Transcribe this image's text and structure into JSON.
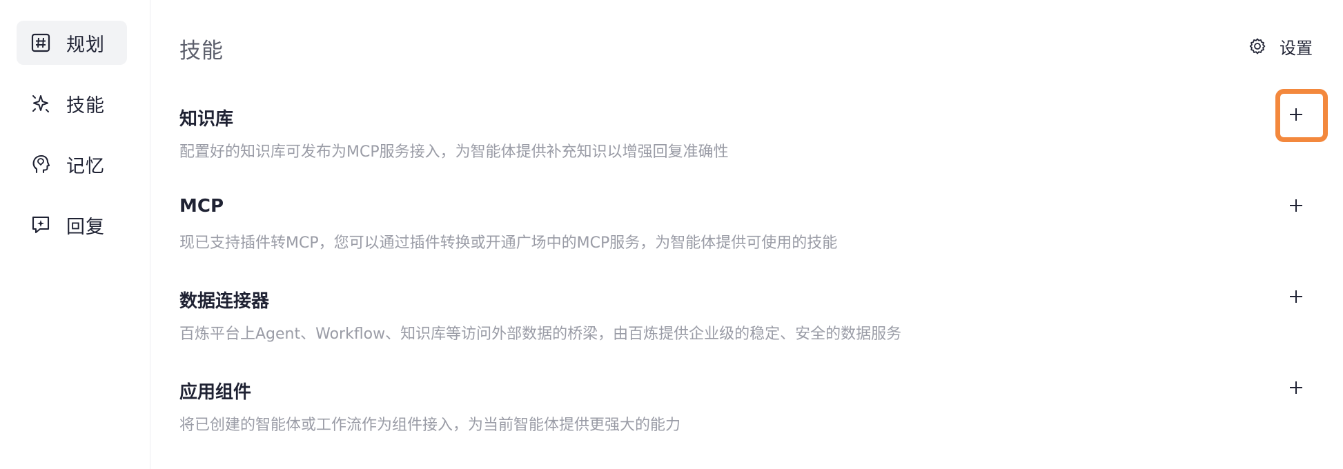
{
  "sidebar": {
    "items": [
      {
        "label": "规划",
        "icon": "hash-icon",
        "active": true
      },
      {
        "label": "技能",
        "icon": "sparkle-icon",
        "active": false
      },
      {
        "label": "记忆",
        "icon": "head-icon",
        "active": false
      },
      {
        "label": "回复",
        "icon": "chat-sparkle-icon",
        "active": false
      }
    ]
  },
  "header": {
    "title": "技能",
    "settings_label": "设置",
    "settings_icon": "gear-icon"
  },
  "sections": [
    {
      "title": "知识库",
      "description": "配置好的知识库可发布为MCP服务接入，为智能体提供补充知识以增强回复准确性",
      "add_icon": "plus-icon"
    },
    {
      "title": "MCP",
      "description": "现已支持插件转MCP，您可以通过插件转换或开通广场中的MCP服务，为智能体提供可使用的技能",
      "add_icon": "plus-icon"
    },
    {
      "title": "数据连接器",
      "description": "百炼平台上Agent、Workflow、知识库等访问外部数据的桥梁，由百炼提供企业级的稳定、安全的数据服务",
      "add_icon": "plus-icon"
    },
    {
      "title": "应用组件",
      "description": "将已创建的智能体或工作流作为组件接入，为当前智能体提供更强大的能力",
      "add_icon": "plus-icon"
    }
  ],
  "colors": {
    "highlight": "#f3883d",
    "active_bg": "#f2f3f5",
    "description": "#9a9ca6",
    "text": "#1f2233"
  }
}
